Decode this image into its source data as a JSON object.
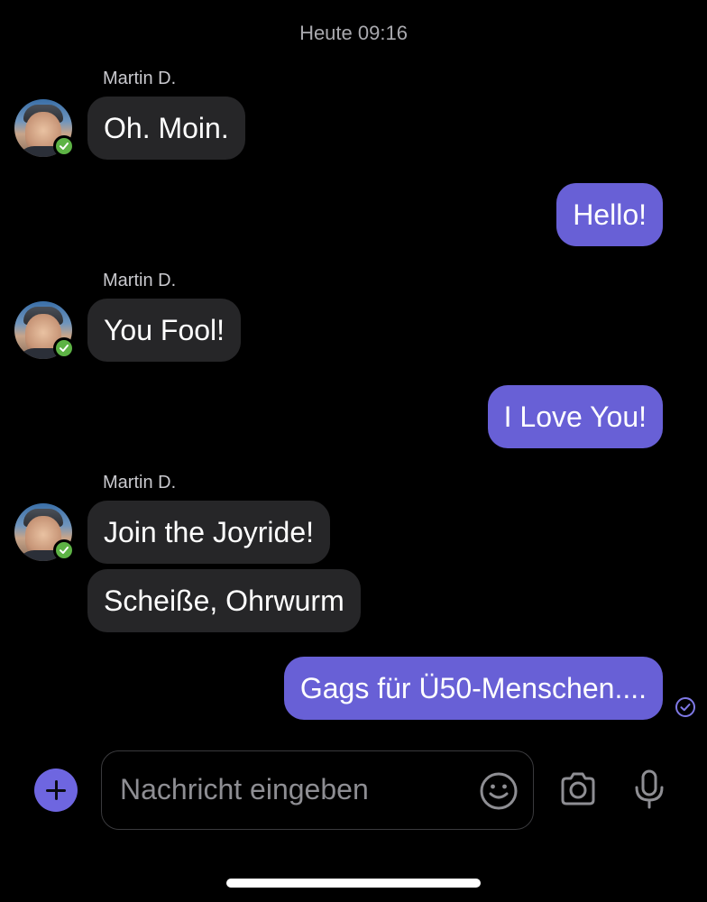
{
  "timestamp": "Heute 09:16",
  "contact": {
    "name": "Martin D."
  },
  "messages": {
    "m1": "Oh. Moin.",
    "m2": "Hello!",
    "m3": "You Fool!",
    "m4": "I Love You!",
    "m5": "Join the Joyride!",
    "m6": "Scheiße, Ohrwurm",
    "m7": "Gags für Ü50-Menschen...."
  },
  "composer": {
    "placeholder": "Nachricht eingeben",
    "add_icon": "plus-icon",
    "emoji_icon": "smiley-icon",
    "camera_icon": "camera-icon",
    "mic_icon": "microphone-icon"
  },
  "colors": {
    "outgoing_bubble": "#6860d6",
    "incoming_bubble": "#262628",
    "verified_badge": "#5db345",
    "accent": "#6e66e0"
  }
}
